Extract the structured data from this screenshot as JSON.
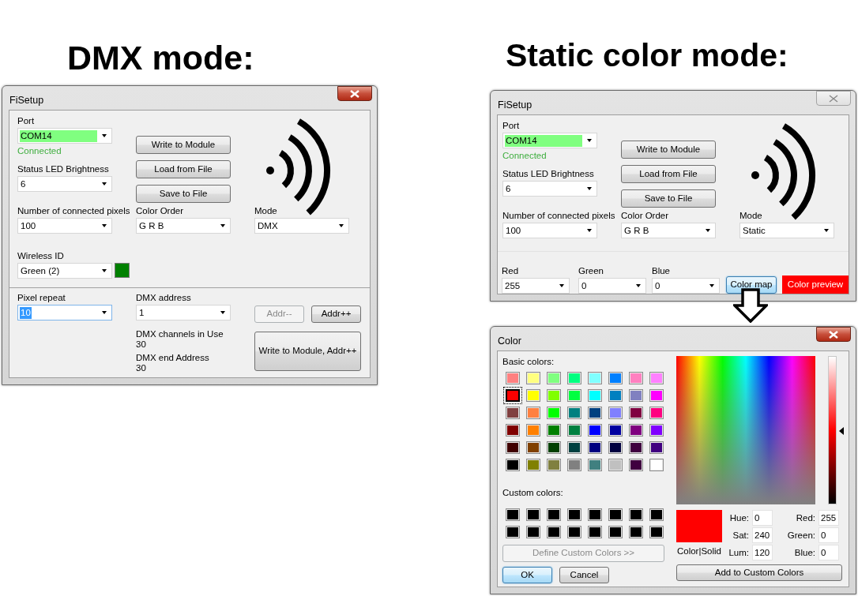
{
  "headings": [
    {
      "text": "DMX mode:"
    },
    {
      "text": "Static color mode:"
    }
  ],
  "dmx_window": {
    "title": "FiSetup",
    "active": true,
    "port": {
      "label": "Port",
      "value": "COM14",
      "connected": true,
      "status": "Connected"
    },
    "brightness": {
      "label": "Status LED Brightness",
      "value": "6"
    },
    "buttons": [
      {
        "label": "Write to Module"
      },
      {
        "label": "Load from File"
      },
      {
        "label": "Save to File"
      }
    ],
    "pixels": {
      "label": "Number of connected pixels",
      "value": "100"
    },
    "color_order": {
      "label": "Color Order",
      "value": "G R B"
    },
    "mode": {
      "label": "Mode",
      "value": "DMX"
    },
    "wireless": {
      "label": "Wireless ID",
      "value": "Green (2)",
      "color": "#008000"
    },
    "pixel_repeat": {
      "label": "Pixel repeat",
      "value": "10",
      "selected": true
    },
    "dmx_address": {
      "label": "DMX address",
      "value": "1",
      "selected": false
    },
    "addr_buttons": [
      {
        "label": "Addr--",
        "disabled": true
      },
      {
        "label": "Addr++",
        "disabled": false
      }
    ],
    "info": [
      {
        "label": "DMX channels in Use",
        "value": "30"
      },
      {
        "label": "DMX end Address",
        "value": "30"
      }
    ],
    "write_next": {
      "label": "Write to Module, Addr++"
    }
  },
  "static_window": {
    "title": "FiSetup",
    "active": false,
    "port": {
      "label": "Port",
      "value": "COM14",
      "connected": true,
      "status": "Connected"
    },
    "brightness": {
      "label": "Status LED Brightness",
      "value": "6"
    },
    "buttons": [
      {
        "label": "Write to Module"
      },
      {
        "label": "Load from File"
      },
      {
        "label": "Save to File"
      }
    ],
    "pixels": {
      "label": "Number of connected pixels",
      "value": "100"
    },
    "color_order": {
      "label": "Color Order",
      "value": "G R B"
    },
    "mode": {
      "label": "Mode",
      "value": "Static"
    },
    "channels": [
      {
        "label": "Red",
        "value": "255"
      },
      {
        "label": "Green",
        "value": "0"
      },
      {
        "label": "Blue",
        "value": "0"
      }
    ],
    "color_map_button": {
      "label": "Color map",
      "focused": true
    },
    "preview": {
      "label": "Color preview",
      "color": "#ff0000"
    }
  },
  "color_dialog": {
    "title": "Color",
    "active": true,
    "basic_label": "Basic colors:",
    "basic_colors": [
      {
        "color": "#ff8080",
        "selected": false
      },
      {
        "color": "#ffff80",
        "selected": false
      },
      {
        "color": "#80ff80",
        "selected": false
      },
      {
        "color": "#00ff80",
        "selected": false
      },
      {
        "color": "#80ffff",
        "selected": false
      },
      {
        "color": "#0080ff",
        "selected": false
      },
      {
        "color": "#ff80c0",
        "selected": false
      },
      {
        "color": "#ff80ff",
        "selected": false
      },
      {
        "color": "#ff0000",
        "selected": true
      },
      {
        "color": "#ffff00",
        "selected": false
      },
      {
        "color": "#80ff00",
        "selected": false
      },
      {
        "color": "#00ff40",
        "selected": false
      },
      {
        "color": "#00ffff",
        "selected": false
      },
      {
        "color": "#0080c0",
        "selected": false
      },
      {
        "color": "#8080c0",
        "selected": false
      },
      {
        "color": "#ff00ff",
        "selected": false
      },
      {
        "color": "#804040",
        "selected": false
      },
      {
        "color": "#ff8040",
        "selected": false
      },
      {
        "color": "#00ff00",
        "selected": false
      },
      {
        "color": "#008080",
        "selected": false
      },
      {
        "color": "#004080",
        "selected": false
      },
      {
        "color": "#8080ff",
        "selected": false
      },
      {
        "color": "#800040",
        "selected": false
      },
      {
        "color": "#ff0080",
        "selected": false
      },
      {
        "color": "#800000",
        "selected": false
      },
      {
        "color": "#ff8000",
        "selected": false
      },
      {
        "color": "#008000",
        "selected": false
      },
      {
        "color": "#008040",
        "selected": false
      },
      {
        "color": "#0000ff",
        "selected": false
      },
      {
        "color": "#0000a0",
        "selected": false
      },
      {
        "color": "#800080",
        "selected": false
      },
      {
        "color": "#8000ff",
        "selected": false
      },
      {
        "color": "#400000",
        "selected": false
      },
      {
        "color": "#804000",
        "selected": false
      },
      {
        "color": "#004000",
        "selected": false
      },
      {
        "color": "#004040",
        "selected": false
      },
      {
        "color": "#000080",
        "selected": false
      },
      {
        "color": "#000040",
        "selected": false
      },
      {
        "color": "#400040",
        "selected": false
      },
      {
        "color": "#400080",
        "selected": false
      },
      {
        "color": "#000000",
        "selected": false
      },
      {
        "color": "#808000",
        "selected": false
      },
      {
        "color": "#808040",
        "selected": false
      },
      {
        "color": "#808080",
        "selected": false
      },
      {
        "color": "#408080",
        "selected": false
      },
      {
        "color": "#c0c0c0",
        "selected": false
      },
      {
        "color": "#400040",
        "selected": false
      },
      {
        "color": "#ffffff",
        "selected": false
      }
    ],
    "custom_label": "Custom colors:",
    "custom_colors": [
      {
        "color": "#000000"
      },
      {
        "color": "#000000"
      },
      {
        "color": "#000000"
      },
      {
        "color": "#000000"
      },
      {
        "color": "#000000"
      },
      {
        "color": "#000000"
      },
      {
        "color": "#000000"
      },
      {
        "color": "#000000"
      },
      {
        "color": "#000000"
      },
      {
        "color": "#000000"
      },
      {
        "color": "#000000"
      },
      {
        "color": "#000000"
      },
      {
        "color": "#000000"
      },
      {
        "color": "#000000"
      },
      {
        "color": "#000000"
      },
      {
        "color": "#000000"
      }
    ],
    "define_button": {
      "label": "Define Custom Colors >>",
      "disabled": true
    },
    "ok_button": {
      "label": "OK",
      "focused": true
    },
    "cancel_button": {
      "label": "Cancel",
      "focused": false
    },
    "luminance": {
      "level": 0.5
    },
    "preview": {
      "color": "#ff0000",
      "label": "Color|Solid"
    },
    "hsl_fields": [
      {
        "label": "Hue:",
        "value": "0"
      },
      {
        "label": "Sat:",
        "value": "240"
      },
      {
        "label": "Lum:",
        "value": "120"
      }
    ],
    "rgb_fields": [
      {
        "label": "Red:",
        "value": "255"
      },
      {
        "label": "Green:",
        "value": "0"
      },
      {
        "label": "Blue:",
        "value": "0"
      }
    ],
    "add_button": {
      "label": "Add to Custom Colors"
    }
  }
}
